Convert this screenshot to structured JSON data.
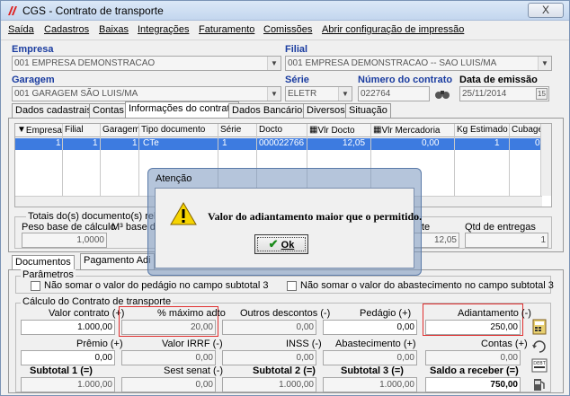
{
  "window": {
    "title": "CGS - Contrato de transporte",
    "close_label": "X"
  },
  "menu": [
    "Saída",
    "Cadastros",
    "Baixas",
    "Integrações",
    "Faturamento",
    "Comissões",
    "Abrir configuração de impressão"
  ],
  "header": {
    "empresa_label": "Empresa",
    "empresa_value": "001 EMPRESA DEMONSTRACAO",
    "filial_label": "Filial",
    "filial_value": "001 EMPRESA DEMONSTRACAO -- SAO LUIS/MA",
    "garagem_label": "Garagem",
    "garagem_value": "001 GARAGEM SÃO LUIS/MA",
    "serie_label": "Série",
    "serie_value": "ELETR",
    "numero_label": "Número do contrato",
    "numero_value": "022764",
    "data_label": "Data de emissão",
    "data_value": "25/11/2014"
  },
  "tabs": [
    "Dados cadastrais",
    "Contas",
    "Informações do contrato",
    "Dados Bancários",
    "Diversos",
    "Situação"
  ],
  "grid": {
    "columns": [
      "Empresa",
      "Filial",
      "Garagem",
      "Tipo documento",
      "Série",
      "Docto",
      "Vlr Docto",
      "Vlr Mercadoria",
      "Kg Estimado",
      "Cubagem"
    ],
    "row": [
      "1",
      "1",
      "1",
      "CTe",
      "1",
      "000022766",
      "12,05",
      "0,00",
      "1",
      "0"
    ]
  },
  "totals": {
    "title": "Totais do(s) documento(s) relaci",
    "peso_label": "Peso base de cálculo",
    "peso_value": "1,0000",
    "m3_label": "M³ base d",
    "ate_label": "te",
    "ate_value": "12,05",
    "qtd_label": "Qtd de entregas",
    "qtd_value": "1"
  },
  "subtabs": [
    "Documentos",
    "Pagamento Adi"
  ],
  "params": {
    "title": "Parâmetros",
    "chk1": "Não somar o valor do pedágio no campo subtotal 3",
    "chk2": "Não somar o valor do abastecimento no campo subtotal 3"
  },
  "calc": {
    "title": "Cálculo do Contrato de transporte",
    "valor_contrato_label": "Valor contrato (+)",
    "valor_contrato": "1.000,00",
    "max_adto_label": "% máximo adto",
    "max_adto": "20,00",
    "outros_label": "Outros descontos (-)",
    "outros": "0,00",
    "pedagio_label": "Pedágio (+)",
    "pedagio": "0,00",
    "adiant_label": "Adiantamento (-)",
    "adiant": "250,00",
    "premio_label": "Prêmio (+)",
    "premio": "0,00",
    "irrf_label": "Valor IRRF (-)",
    "irrf": "0,00",
    "inss_label": "INSS (-)",
    "inss": "0,00",
    "abast_label": "Abastecimento (+)",
    "abast": "0,00",
    "contas_label": "Contas (+)",
    "contas": "0,00",
    "sub1_label": "Subtotal 1 (=)",
    "sub1": "1.000,00",
    "senat_label": "Sest senat (-)",
    "senat": "0,00",
    "sub2_label": "Subtotal 2 (=)",
    "sub2": "1.000,00",
    "sub3_label": "Subtotal 3 (=)",
    "sub3": "1.000,00",
    "saldo_label": "Saldo a receber (=)",
    "saldo": "750,00"
  },
  "dialog": {
    "title": "Atenção",
    "message": "Valor do adiantamento maior que o permitido.",
    "ok_label": "Ok"
  },
  "colors": {
    "accent": "#1a3ca0",
    "selection": "#3d7be0",
    "highlight": "#e03030"
  }
}
